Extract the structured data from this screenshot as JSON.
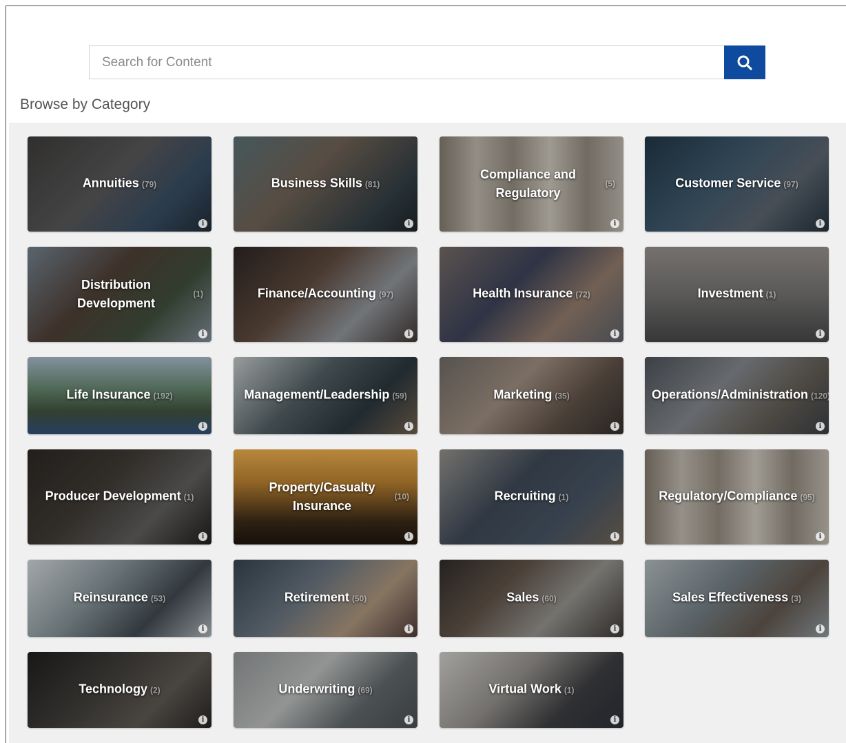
{
  "search": {
    "placeholder": "Search for Content"
  },
  "browse": {
    "title": "Browse by Category"
  },
  "categories": [
    {
      "name": "Annuities",
      "count": "(79)",
      "bg": "linear-gradient(135deg,#3b3a38 0%,#545455 45%,#34495e 75%,#202a33 100%)"
    },
    {
      "name": "Business Skills",
      "count": "(81)",
      "bg": "linear-gradient(135deg,#566b6f 0%,#6b5e52 40%,#2e3a3f 80%,#1d2326 100%)"
    },
    {
      "name": "Compliance and Regulatory",
      "count": "(5)",
      "bg": "linear-gradient(90deg,#7c7469 0%,#b3ada3 20%,#8d857a 40%,#c2bcb2 60%,#8a8378 80%,#b4aea4 100%)"
    },
    {
      "name": "Customer Service",
      "count": "(97)",
      "bg": "linear-gradient(135deg,#1f3443 0%,#3b5467 40%,#57606a 70%,#23303a 100%)"
    },
    {
      "name": "Distribution Development",
      "count": "(1)",
      "bg": "linear-gradient(135deg,#6d7b88 0%,#4b3d33 40%,#3d4b3a 70%,#7b8791 100%)"
    },
    {
      "name": "Finance/Accounting",
      "count": "(97)",
      "bg": "linear-gradient(135deg,#2b2422 0%,#5a473b 40%,#8a8e93 70%,#3e3431 100%)"
    },
    {
      "name": "Health Insurance",
      "count": "(72)",
      "bg": "linear-gradient(135deg,#6f6560 0%,#3a3f55 40%,#8b7667 70%,#575c63 100%)"
    },
    {
      "name": "Investment",
      "count": "(1)",
      "bg": "linear-gradient(180deg,#8f8a87 0%,#6f6d6c 50%,#434444 100%)"
    },
    {
      "name": "Life Insurance",
      "count": "(192)",
      "bg": "linear-gradient(180deg,#9fb2c2 0%,#5c7a62 45%,#3e4f3c 70%,#2f4d74 100%)"
    },
    {
      "name": "Management/Leadership",
      "count": "(59)",
      "bg": "linear-gradient(135deg,#b9bfbf 0%,#4f5b5f 40%,#28343a 70%,#6a5b4a 100%)"
    },
    {
      "name": "Marketing",
      "count": "(35)",
      "bg": "linear-gradient(135deg,#6a6562 0%,#97877a 40%,#5b4d44 70%,#322d2a 100%)"
    },
    {
      "name": "Operations/Administration",
      "count": "(120)",
      "bg": "linear-gradient(135deg,#4a4f56 0%,#7e8186 40%,#5f5a52 70%,#383c40 100%)"
    },
    {
      "name": "Producer Development",
      "count": "(1)",
      "bg": "linear-gradient(135deg,#2a2623 0%,#3c3833 40%,#5b5a59 70%,#1f1c1a 100%)"
    },
    {
      "name": "Property/Casualty Insurance",
      "count": "(10)",
      "bg": "linear-gradient(180deg,#e0a64a 0%,#b07a2e 35%,#3a2a18 75%,#1c140c 100%)"
    },
    {
      "name": "Recruiting",
      "count": "(1)",
      "bg": "linear-gradient(135deg,#8d8a85 0%,#3b4552 40%,#44515f 70%,#6b5f52 100%)"
    },
    {
      "name": "Regulatory/Compliance",
      "count": "(95)",
      "bg": "linear-gradient(90deg,#7c7469 0%,#b6b0a6 20%,#8d857a 40%,#c4beb4 60%,#8a8378 80%,#b8b2a8 100%)"
    },
    {
      "name": "Reinsurance",
      "count": "(53)",
      "bg": "linear-gradient(135deg,#c6cccf 0%,#7d8a8e 40%,#3e464c 70%,#a3abb0 100%)"
    },
    {
      "name": "Retirement",
      "count": "(50)",
      "bg": "linear-gradient(135deg,#33414c 0%,#65707a 40%,#a58f78 70%,#4c3a37 100%)"
    },
    {
      "name": "Sales",
      "count": "(60)",
      "bg": "linear-gradient(135deg,#2e2a28 0%,#5c4f45 35%,#8e8c87 65%,#3a3634 100%)"
    },
    {
      "name": "Sales Effectiveness",
      "count": "(3)",
      "bg": "linear-gradient(135deg,#aab2b6 0%,#6f7a7f 40%,#5d534a 70%,#889297 100%)"
    },
    {
      "name": "Technology",
      "count": "(2)",
      "bg": "linear-gradient(135deg,#1e1d1c 0%,#3d3b38 40%,#59544f 70%,#262422 100%)"
    },
    {
      "name": "Underwriting",
      "count": "(69)",
      "bg": "linear-gradient(135deg,#8c8f90 0%,#b3b5b4 40%,#5d6366 70%,#474b4d 100%)"
    },
    {
      "name": "Virtual Work",
      "count": "(1)",
      "bg": "linear-gradient(135deg,#c6c4c0 0%,#8d8a86 40%,#3a3b3e 70%,#2a2d36 100%)"
    }
  ]
}
